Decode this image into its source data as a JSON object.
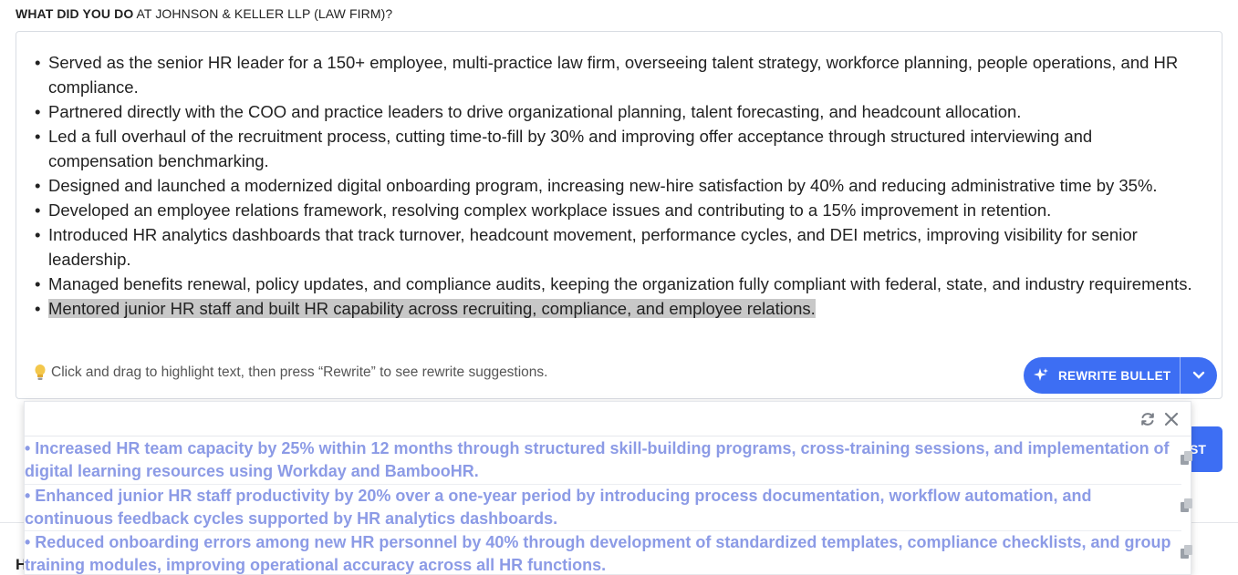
{
  "question": {
    "bold": "WHAT DID YOU DO",
    "rest": " AT JOHNSON & KELLER LLP (LAW FIRM)?"
  },
  "editor": {
    "bullets": [
      "Served as the senior HR leader for a 150+ employee, multi-practice law firm, overseeing talent strategy, workforce planning, people operations, and HR compliance.",
      "Partnered directly with the COO and practice leaders to drive organizational planning, talent forecasting, and headcount allocation.",
      "Led a full overhaul of the recruitment process, cutting time-to-fill by 30% and improving offer acceptance through structured interviewing and compensation benchmarking.",
      "Designed and launched a modernized digital onboarding program, increasing new-hire satisfaction by 40% and reducing administrative time by 35%.",
      "Developed an employee relations framework, resolving complex workplace issues and contributing to a 15% improvement in retention.",
      "Introduced HR analytics dashboards that track turnover, headcount movement, performance cycles, and DEI metrics, improving visibility for senior leadership.",
      "Managed benefits renewal, policy updates, and compliance audits, keeping the organization fully compliant with federal, state, and industry requirements.",
      "Mentored junior HR staff and built HR capability across recruiting, compliance, and employee relations."
    ],
    "hint": "Click and drag to highlight text, then press “Rewrite” to see rewrite suggestions.",
    "rewrite_label": "REWRITE BULLET"
  },
  "background": {
    "button_fragment": "ST",
    "heading_fragment": "H"
  },
  "suggestions": [
    "• Increased HR team capacity by 25% within 12 months through structured skill-building programs, cross-training sessions, and implementation of digital learning resources using Workday and BambooHR.",
    "• Enhanced junior HR staff productivity by 20% over a one-year period by introducing process documentation, workflow automation, and continuous feedback cycles supported by HR analytics dashboards.",
    "• Reduced onboarding errors among new HR personnel by 40% through development of standardized templates, compliance checklists, and group training modules, improving operational accuracy across all HR functions."
  ],
  "colors": {
    "accent": "#3d6ef3",
    "suggestion_text": "#8c9be6",
    "highlight": "#c8c8c8"
  },
  "icons": {
    "hint": "lightbulb-icon",
    "rewrite": "sparkle-icon",
    "dropdown": "chevron-down-icon",
    "refresh": "refresh-icon",
    "close": "close-icon",
    "copy": "copy-icon"
  }
}
